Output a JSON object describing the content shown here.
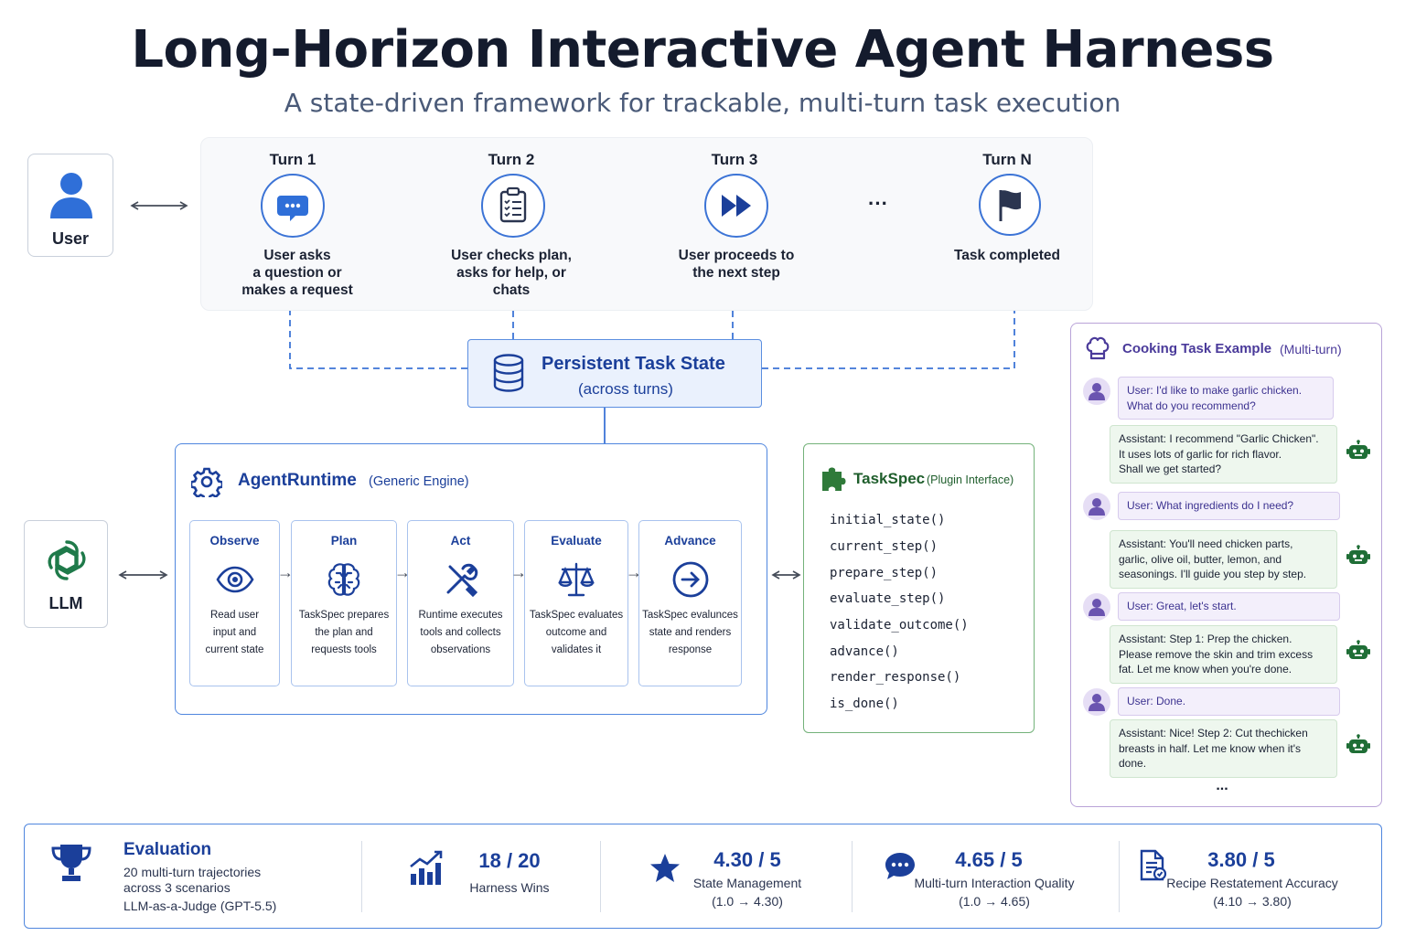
{
  "header": {
    "title": "Long-Horizon Interactive Agent Harness",
    "subtitle": "A state-driven framework for trackable, multi-turn task execution"
  },
  "user": {
    "label": "User"
  },
  "turns": [
    {
      "title": "Turn 1",
      "desc": [
        "User asks",
        "a question or",
        "makes a request"
      ],
      "icon": "chat-bubble-icon"
    },
    {
      "title": "Turn 2",
      "desc": [
        "User checks plan,",
        "asks for help, or",
        "chats"
      ],
      "icon": "clipboard-icon"
    },
    {
      "title": "Turn 3",
      "desc": [
        "User proceeds to",
        "the next step"
      ],
      "icon": "fast-forward-icon"
    },
    {
      "title": "Turn N",
      "desc": [
        "Task completed"
      ],
      "icon": "flag-icon"
    }
  ],
  "turn_ellipsis": "···",
  "state": {
    "title": "Persistent Task State",
    "subtitle": "(across turns)"
  },
  "runtime": {
    "title": "AgentRuntime",
    "subtitle": "(Generic Engine)",
    "stages": [
      {
        "title": "Observe",
        "desc": [
          "Read user",
          "input and",
          "current state"
        ],
        "icon": "eye-icon"
      },
      {
        "title": "Plan",
        "desc": [
          "TaskSpec prepares",
          "the plan and",
          "requests tools"
        ],
        "icon": "brain-icon"
      },
      {
        "title": "Act",
        "desc": [
          "Runtime executes",
          "tools and collects",
          "observations"
        ],
        "icon": "tools-icon"
      },
      {
        "title": "Evaluate",
        "desc": [
          "TaskSpec evaluates",
          "outcome and",
          "validates it"
        ],
        "icon": "scale-icon"
      },
      {
        "title": "Advance",
        "desc": [
          "TaskSpec evalunces",
          "state and renders",
          "response"
        ],
        "icon": "arrow-circle-icon"
      }
    ]
  },
  "llm": {
    "label": "LLM"
  },
  "taskspec": {
    "title": "TaskSpec",
    "subtitle": "(Plugin Interface)",
    "methods": [
      "initial_state()",
      "current_step()",
      "prepare_step()",
      "evaluate_step()",
      "validate_outcome()",
      "advance()",
      "render_response()",
      "is_done()"
    ]
  },
  "cooking": {
    "title": "Cooking Task Example",
    "subtitle": "(Multi-turn)",
    "messages": [
      {
        "role": "user",
        "lines": [
          "User: I'd like to make garlic chicken.",
          "What do you recommend?"
        ]
      },
      {
        "role": "assistant",
        "lines": [
          "Assistant: I recommend \"Garlic Chicken\".",
          "It uses lots of garlic for rich flavor.",
          "Shall we get started?"
        ]
      },
      {
        "role": "user",
        "lines": [
          "User: What ingredients do I need?"
        ]
      },
      {
        "role": "assistant",
        "lines": [
          "Assistant: You'll need chicken parts,",
          "garlic, olive oil, butter, lemon, and",
          "seasonings. I'll guide you step by step."
        ]
      },
      {
        "role": "user",
        "lines": [
          "User: Great, let's start."
        ]
      },
      {
        "role": "assistant",
        "lines": [
          "Assistant: Step 1: Prep the chicken.",
          "Please remove the skin and trim excess",
          "fat. Let me know when you're done."
        ]
      },
      {
        "role": "user",
        "lines": [
          "User: Done."
        ]
      },
      {
        "role": "assistant",
        "lines": [
          "Assistant: Nice! Step 2: Cut thechicken",
          "breasts in half. Let me know when it's",
          "done."
        ]
      }
    ],
    "ellipsis": "..."
  },
  "evaluation": {
    "title": "Evaluation",
    "lines": [
      "20 multi-turn trajectories",
      "across 3 scenarios",
      "LLM-as-a-Judge (GPT-5.5)"
    ],
    "metrics": [
      {
        "value": "18 / 20",
        "label": "Harness Wins",
        "sub": "",
        "icon": "bar-chart-icon"
      },
      {
        "value": "4.30 / 5",
        "label": "State Management",
        "sub": "(1.0 → 4.30)",
        "icon": "star-icon"
      },
      {
        "value": "4.65 / 5",
        "label": "Multi-turn Interaction Quality",
        "sub": "(1.0 → 4.65)",
        "icon": "chat-icon"
      },
      {
        "value": "3.80 / 5",
        "label": "Recipe Restatement Accuracy",
        "sub": "(4.10 → 3.80)",
        "icon": "document-icon"
      }
    ]
  },
  "colors": {
    "accent": "#1b3f9a",
    "blue": "#3c74d6",
    "green": "#1f5e2c",
    "purple": "#4a3a9a"
  }
}
